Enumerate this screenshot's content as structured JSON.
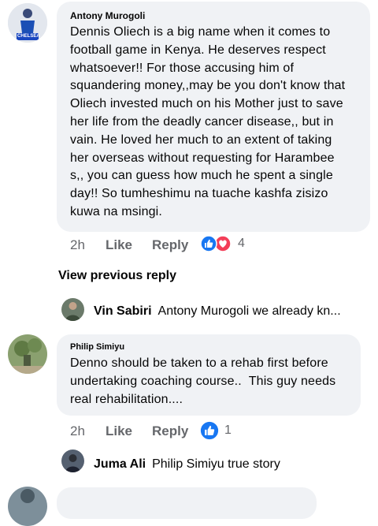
{
  "comments": [
    {
      "author": "Antony Murogoli",
      "lines": [
        "Dennis Oliech is a big name when it comes to",
        "football game in Kenya. He deserves respect",
        "whatsoever!! For those accusing him of",
        "squandering money,,may be you don't know that",
        "Oliech invested much on his Mother just to save",
        "her life from the deadly cancer disease,, but in",
        "vain. He loved her much to an extent of taking",
        "her overseas without requesting for Harambee",
        "s,, you can guess how much he spent a single",
        "day!! So tumheshimu na tuache kashfa zisizo",
        "kuwa na msingi."
      ],
      "time": "2h",
      "like_label": "Like",
      "reply_label": "Reply",
      "reaction_count": "4",
      "avatar_text": "CHELSEA"
    },
    {
      "author": "Philip Simiyu",
      "lines": [
        "Denno should be taken to a rehab first before",
        "undertaking coaching course..  This guy needs",
        "real rehabilitation...."
      ],
      "time": "2h",
      "like_label": "Like",
      "reply_label": "Reply",
      "reaction_count": "1"
    }
  ],
  "view_previous_reply": "View previous reply",
  "replies": [
    {
      "name": "Vin Sabiri",
      "text": "Antony Murogoli we already kn..."
    },
    {
      "name": "Juma Ali",
      "text": "Philip Simiyu true story"
    }
  ],
  "colors": {
    "bubble": "#f0f2f5",
    "meta_text": "#65676b",
    "like_blue": "#1877f2",
    "love_red": "#f33e58"
  }
}
